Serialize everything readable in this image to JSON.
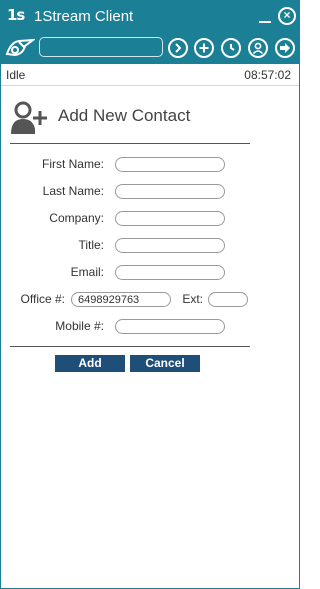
{
  "window": {
    "logo_text": "1s",
    "title": "1Stream Client",
    "minimize_glyph": "",
    "close_glyph": "×"
  },
  "toolbar": {
    "search_value": "",
    "icons": [
      "brand-icon",
      "next-icon",
      "add-icon",
      "history-icon",
      "user-icon",
      "exit-icon"
    ]
  },
  "status": {
    "state": "Idle",
    "time": "08:57:02"
  },
  "form": {
    "title": "Add New Contact",
    "first_name_label": "First Name:",
    "first_name_value": "",
    "last_name_label": "Last Name:",
    "last_name_value": "",
    "company_label": "Company:",
    "company_value": "",
    "title_label": "Title:",
    "title_value": "",
    "email_label": "Email:",
    "email_value": "",
    "office_label": "Office #:",
    "office_value": "6498929763",
    "ext_label": "Ext:",
    "ext_value": "",
    "mobile_label": "Mobile #:",
    "mobile_value": ""
  },
  "actions": {
    "add_label": "Add",
    "cancel_label": "Cancel"
  },
  "colors": {
    "header_bg": "#1b7f95",
    "button_bg": "#1f4e79"
  }
}
